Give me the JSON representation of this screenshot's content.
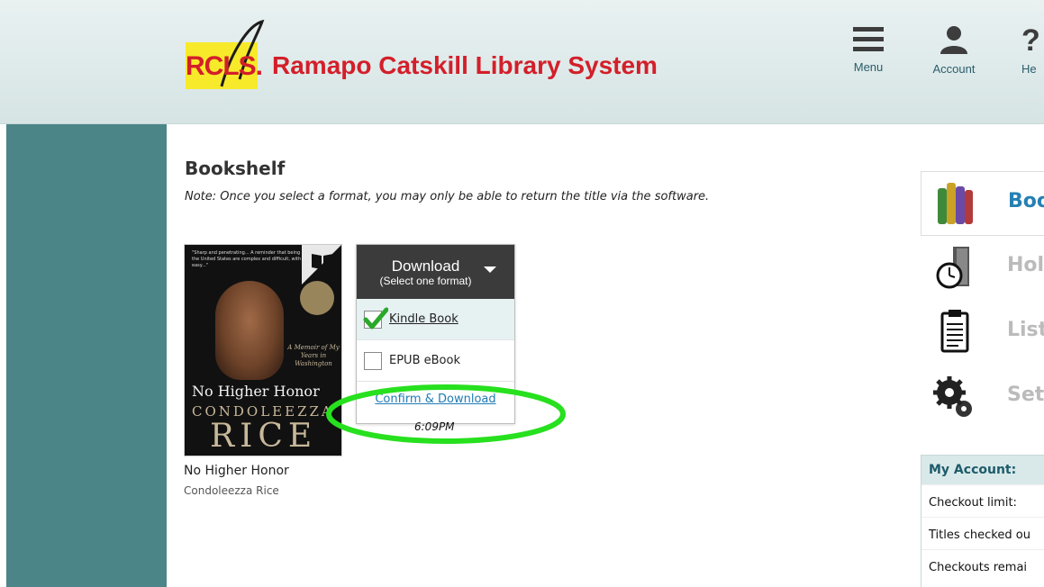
{
  "header": {
    "logo_text": "RCLS.",
    "site_name": "Ramapo Catskill Library System",
    "menu_label": "Menu",
    "account_label": "Account",
    "help_label": "He"
  },
  "page": {
    "title": "Bookshelf",
    "note": "Note: Once you select a format, you may only be able to return the title via the software."
  },
  "book": {
    "title": "No Higher Honor",
    "author": "Condoleezza Rice",
    "cover_title": "No Higher Honor",
    "cover_author_first": "CONDOLEEZZA",
    "cover_author_last": "RICE",
    "cover_blurb": "\"Sharp and penetrating... A reminder that being the United States are complex and difficult, with no easy...\"",
    "cover_tagline": "A Memoir of My Years in Washington"
  },
  "download": {
    "heading": "Download",
    "subheading": "(Select one format)",
    "options": [
      {
        "label": "Kindle Book",
        "selected": true
      },
      {
        "label": "EPUB eBook",
        "selected": false
      }
    ],
    "confirm_label": "Confirm & Download",
    "time": "6:09PM"
  },
  "side_nav": {
    "items": [
      {
        "label": "Boo",
        "icon": "books-icon"
      },
      {
        "label": "Hol",
        "icon": "stopwatch-icon"
      },
      {
        "label": "List",
        "icon": "clipboard-icon"
      },
      {
        "label": "Sett",
        "icon": "gears-icon"
      }
    ]
  },
  "my_account": {
    "heading": "My Account:",
    "rows": [
      "Checkout limit:",
      "Titles checked ou",
      "Checkouts remai"
    ]
  },
  "colors": {
    "brand_red": "#d31f2a",
    "logo_yellow": "#f7ea2a",
    "rail_teal": "#4b8587",
    "link_blue": "#1f7bb5",
    "highlight_green": "#27e01e"
  }
}
